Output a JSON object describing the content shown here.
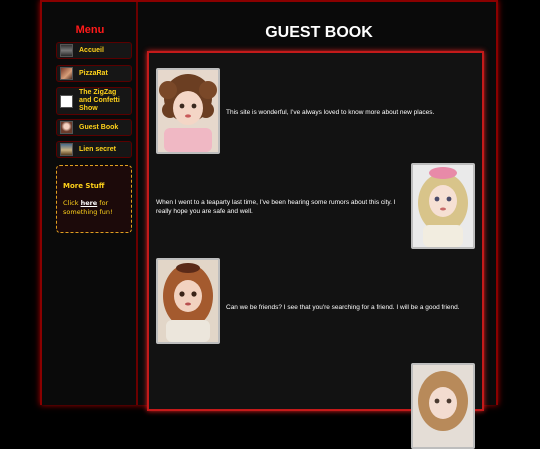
{
  "sidebar": {
    "menu_title": "Menu",
    "items": [
      {
        "label": "Accueil",
        "icon": "house-thumbnail-icon"
      },
      {
        "label": "PizzaRat",
        "icon": "rat-thumbnail-icon"
      },
      {
        "label": "The ZigZag and Confetti Show",
        "icon": "blank-thumbnail-icon"
      },
      {
        "label": "Guest Book",
        "icon": "doll-thumbnail-icon"
      },
      {
        "label": "Lien secret",
        "icon": "castle-thumbnail-icon"
      }
    ],
    "more": {
      "title": "More Stuff",
      "text_before": "Click ",
      "link": "here",
      "text_after": " for something fun!"
    }
  },
  "main": {
    "title": "GUEST BOOK",
    "entries": [
      {
        "text": "This site is wonderful, I've always loved to know more about new places.",
        "image": "doll-portrait-brown-curls"
      },
      {
        "text": "When I went to a teaparty last time, I've been hearing some rumors about this city. I really hope you are safe and well.",
        "image": "doll-portrait-blonde-pink-bow"
      },
      {
        "text": "Can we be friends? I see that you're searching for a friend. I will be a good friend.",
        "image": "doll-portrait-red-hair"
      },
      {
        "text": "",
        "image": "doll-portrait-light-brown-hair"
      }
    ]
  },
  "colors": {
    "accent_red": "#c41a1a",
    "menu_title": "#ff1a1a",
    "nav_text": "#ffd21a",
    "background": "#000000"
  }
}
